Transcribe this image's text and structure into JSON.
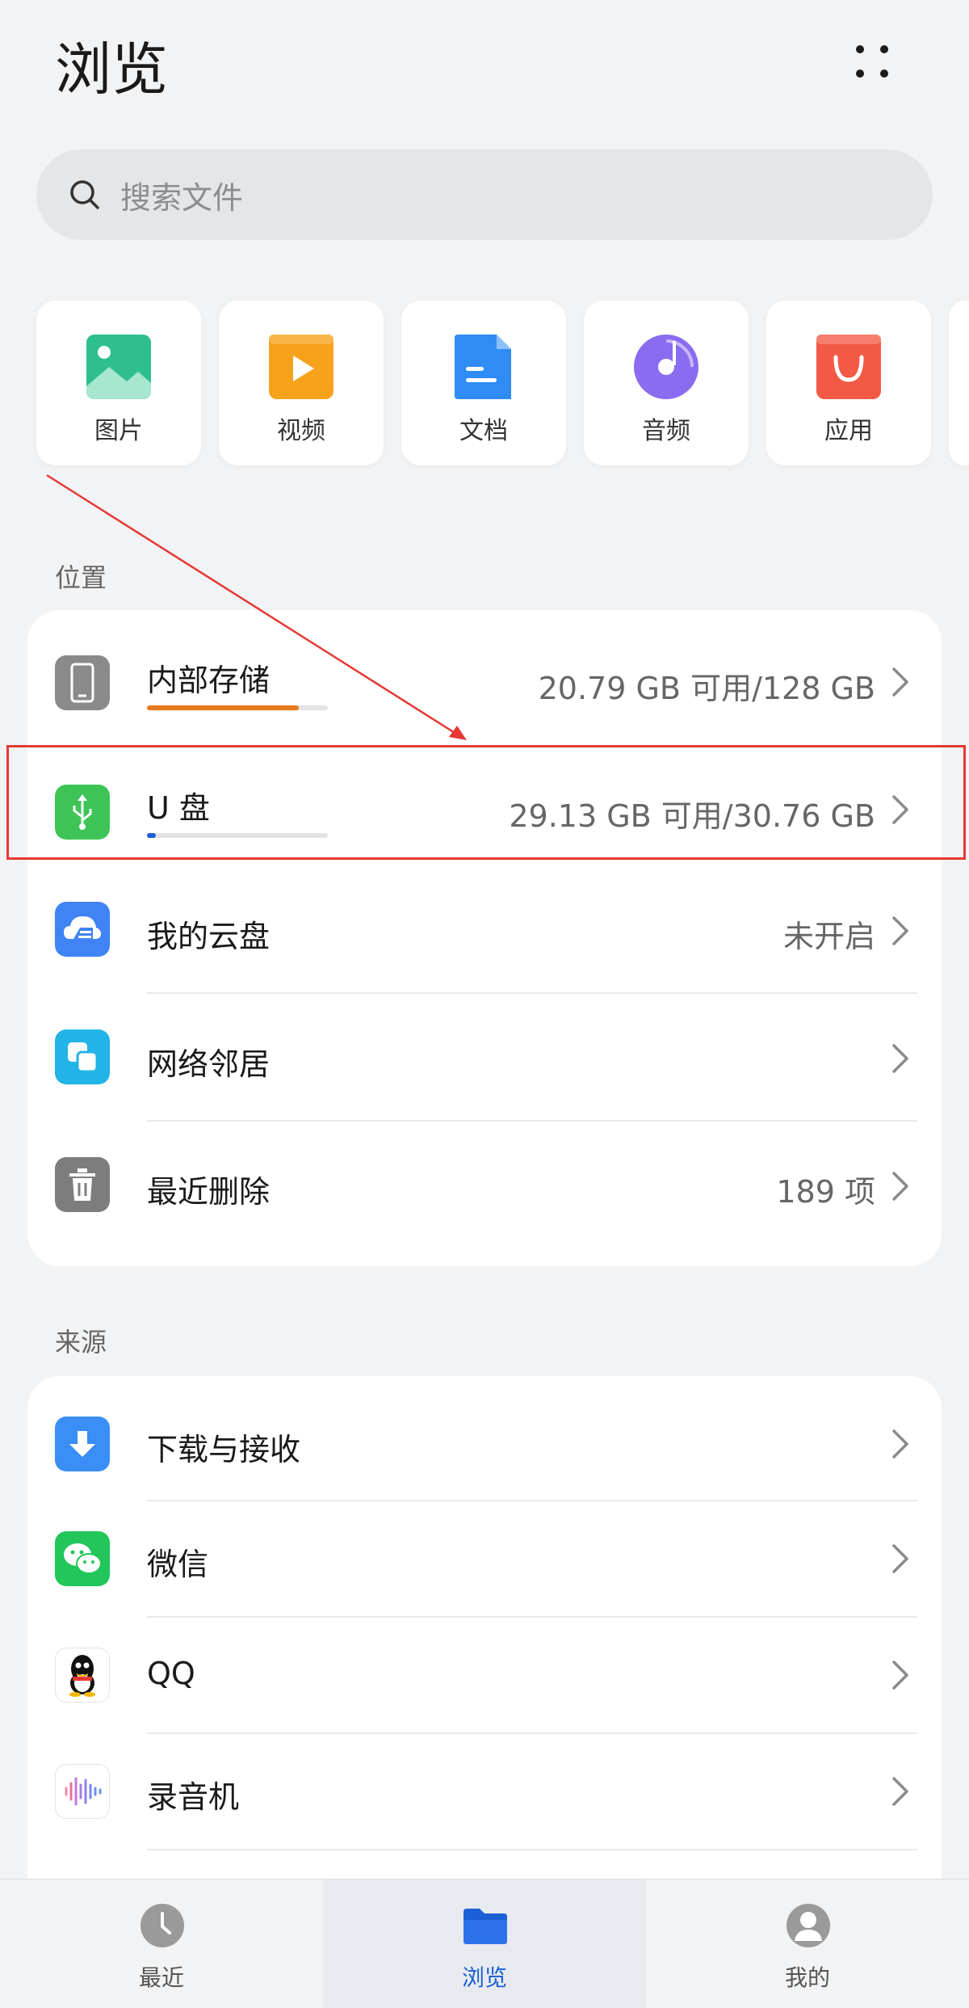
{
  "header": {
    "title": "浏览"
  },
  "search": {
    "placeholder": "搜索文件"
  },
  "categories": [
    {
      "label": "图片",
      "icon": "image-icon",
      "color": "#2fbf8f"
    },
    {
      "label": "视频",
      "icon": "video-icon",
      "color": "#f7a21b"
    },
    {
      "label": "文档",
      "icon": "document-icon",
      "color": "#2f8cf5"
    },
    {
      "label": "音频",
      "icon": "audio-icon",
      "color": "#8a6cf0"
    },
    {
      "label": "应用",
      "icon": "app-icon",
      "color": "#f25a45"
    }
  ],
  "locations": {
    "label": "位置",
    "items": [
      {
        "title": "内部存储",
        "value": "20.79 GB 可用/128 GB",
        "icon": "phone-icon",
        "usage": 0.84,
        "bar_color": "#e8791e"
      },
      {
        "title": "U 盘",
        "value": "29.13 GB 可用/30.76 GB",
        "icon": "usb-icon",
        "usage": 0.05,
        "bar_color": "#1a5fd6"
      },
      {
        "title": "我的云盘",
        "value": "未开启",
        "icon": "cloud-icon"
      },
      {
        "title": "网络邻居",
        "value": "",
        "icon": "network-icon"
      },
      {
        "title": "最近删除",
        "value": "189 项",
        "icon": "trash-icon"
      }
    ]
  },
  "sources": {
    "label": "来源",
    "items": [
      {
        "title": "下载与接收",
        "icon": "download-icon"
      },
      {
        "title": "微信",
        "icon": "wechat-icon"
      },
      {
        "title": "QQ",
        "icon": "qq-icon"
      },
      {
        "title": "录音机",
        "icon": "recorder-icon"
      }
    ]
  },
  "bottom_nav": [
    {
      "label": "最近",
      "icon": "clock-icon",
      "active": false
    },
    {
      "label": "浏览",
      "icon": "folder-icon",
      "active": true
    },
    {
      "label": "我的",
      "icon": "user-icon",
      "active": false
    }
  ],
  "colors": {
    "accent": "#1a5fd6",
    "highlight": "#e53935",
    "background": "#f1f3f5"
  }
}
